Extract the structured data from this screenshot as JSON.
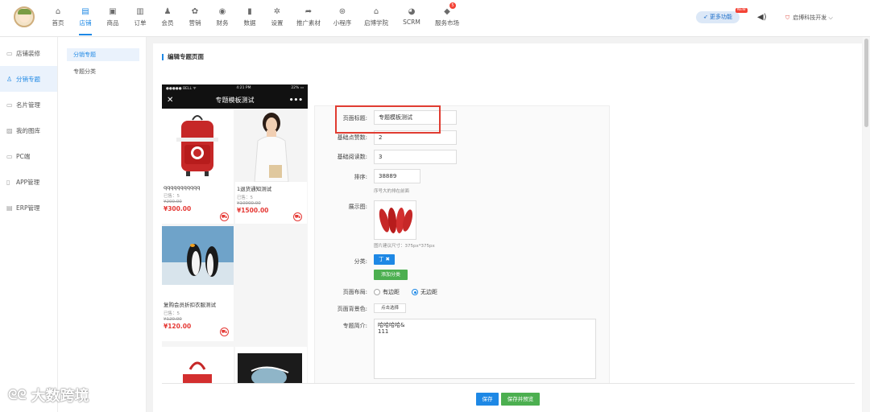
{
  "nav": [
    {
      "label": "首页",
      "icon": "home-icon",
      "glyph": "⌂"
    },
    {
      "label": "店铺",
      "icon": "store-icon",
      "glyph": "▤",
      "active": true
    },
    {
      "label": "商品",
      "icon": "goods-icon",
      "glyph": "▣"
    },
    {
      "label": "订单",
      "icon": "order-icon",
      "glyph": "▥"
    },
    {
      "label": "会员",
      "icon": "member-icon",
      "glyph": "♟"
    },
    {
      "label": "营销",
      "icon": "marketing-icon",
      "glyph": "✿"
    },
    {
      "label": "财务",
      "icon": "finance-icon",
      "glyph": "◉"
    },
    {
      "label": "数据",
      "icon": "data-icon",
      "glyph": "▮"
    },
    {
      "label": "设置",
      "icon": "settings-icon",
      "glyph": "✲"
    },
    {
      "label": "推广素材",
      "icon": "share-icon",
      "glyph": "➦"
    },
    {
      "label": "小程序",
      "icon": "miniapp-icon",
      "glyph": "⊛"
    },
    {
      "label": "启博学院",
      "icon": "academy-icon",
      "glyph": "⌂"
    },
    {
      "label": "SCRM",
      "icon": "scrm-icon",
      "glyph": "◕"
    },
    {
      "label": "服务市场",
      "icon": "market-icon",
      "glyph": "◆",
      "badge": "5"
    }
  ],
  "header": {
    "more_label": "更多功能",
    "new_tag": "NEW",
    "company": "启博科技开发"
  },
  "sidebar": [
    {
      "label": "店铺装修",
      "icon": "decorate-icon",
      "glyph": "▭"
    },
    {
      "label": "分销专题",
      "icon": "distribution-icon",
      "glyph": "♙",
      "active": true
    },
    {
      "label": "名片管理",
      "icon": "card-icon",
      "glyph": "▭"
    },
    {
      "label": "我的图库",
      "icon": "gallery-icon",
      "glyph": "▨"
    },
    {
      "label": "PC端",
      "icon": "pc-icon",
      "glyph": "▭"
    },
    {
      "label": "APP管理",
      "icon": "app-icon",
      "glyph": "▯"
    },
    {
      "label": "ERP管理",
      "icon": "erp-icon",
      "glyph": "▤"
    }
  ],
  "subnav": [
    {
      "label": "分销专题",
      "active": true
    },
    {
      "label": "专题分类"
    }
  ],
  "main_title": "编辑专题页面",
  "phone": {
    "status_left": "●●●●● BELL ᯤ",
    "status_time": "4:21 PM",
    "status_right": "22% ▭",
    "title": "专题模板测试",
    "products": [
      {
        "name": "qqqqqqqqqqq",
        "sold": "已售：5",
        "orig": "¥200.00",
        "price": "¥300.00"
      },
      {
        "name": "1退货通知测试",
        "sold": "已售：5",
        "orig": "¥10000.00",
        "price": "¥1500.00"
      },
      {
        "name": "复购会员折扣衣服测试",
        "sold": "已售：5",
        "orig": "¥120.00",
        "price": "¥120.00"
      }
    ]
  },
  "form": {
    "title_label": "页面标题:",
    "title_value": "专题模板测试",
    "likes_label": "基础点赞数:",
    "likes_value": "2",
    "reads_label": "基础阅读数:",
    "reads_value": "3",
    "sort_label": "排序:",
    "sort_value": "38889",
    "sort_hint": "序号大的排在前面",
    "image_label": "展示图:",
    "image_hint": "图片建议尺寸：375px*375px",
    "category_label": "分类:",
    "category_tag": "丁 ✖",
    "add_category": "添加分类",
    "layout_label": "页面布局:",
    "layout_option1": "有边距",
    "layout_option2": "无边距",
    "bg_label": "页面背景色:",
    "bg_button": "点击选择",
    "intro_label": "专题简介:",
    "intro_value": "哈哈哈哈&\n111"
  },
  "footer": {
    "save": "保存",
    "save_preview": "保存并预览"
  },
  "watermark": "大数跨境"
}
